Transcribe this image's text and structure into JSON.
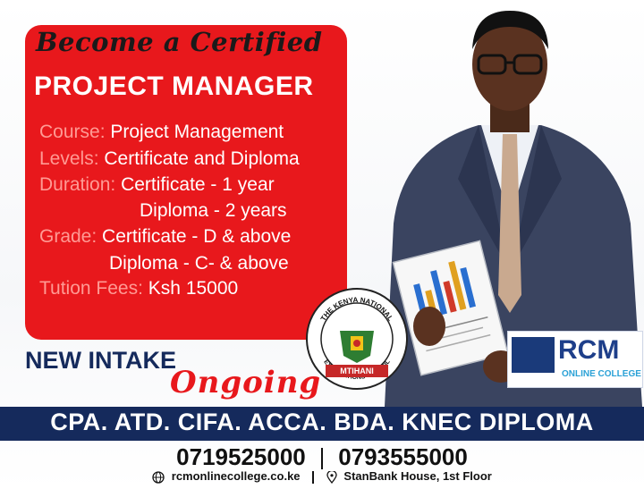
{
  "header": {
    "script_title": "Become a Certified",
    "main_title": "PROJECT MANAGER"
  },
  "details": {
    "course_label": "Course:",
    "course_value": "Project Management",
    "levels_label": "Levels:",
    "levels_value": "Certificate and Diploma",
    "duration_label": "Duration:",
    "duration_value_1": "Certificate - 1 year",
    "duration_value_2": "Diploma - 2 years",
    "grade_label": "Grade:",
    "grade_value_1": "Certificate - D & above",
    "grade_value_2": "Diploma - C- & above",
    "fees_label": "Tution Fees:",
    "fees_value": "Ksh 15000"
  },
  "seal": {
    "top_text": "THE KENYA NATIONAL",
    "bottom_text": "EXAMINATIONS COUNCIL",
    "banner_text": "MTIHANI"
  },
  "intake": {
    "label": "NEW INTAKE",
    "status": "Ongoing"
  },
  "logo": {
    "word": "RCM",
    "sub": "ONLINE COLLEGE"
  },
  "courses_line": "CPA. ATD. CIFA. ACCA. BDA. KNEC DIPLOMA",
  "phones": {
    "phone_1": "0719525000",
    "phone_2": "0793555000"
  },
  "contact": {
    "website": "rcmonlinecollege.co.ke",
    "address": "StanBank House, 1st Floor"
  },
  "icons": [
    "globe-icon",
    "location-pin-icon"
  ],
  "colors": {
    "red": "#e8181c",
    "navy": "#152a5c",
    "label_pink": "#ff9a94"
  }
}
